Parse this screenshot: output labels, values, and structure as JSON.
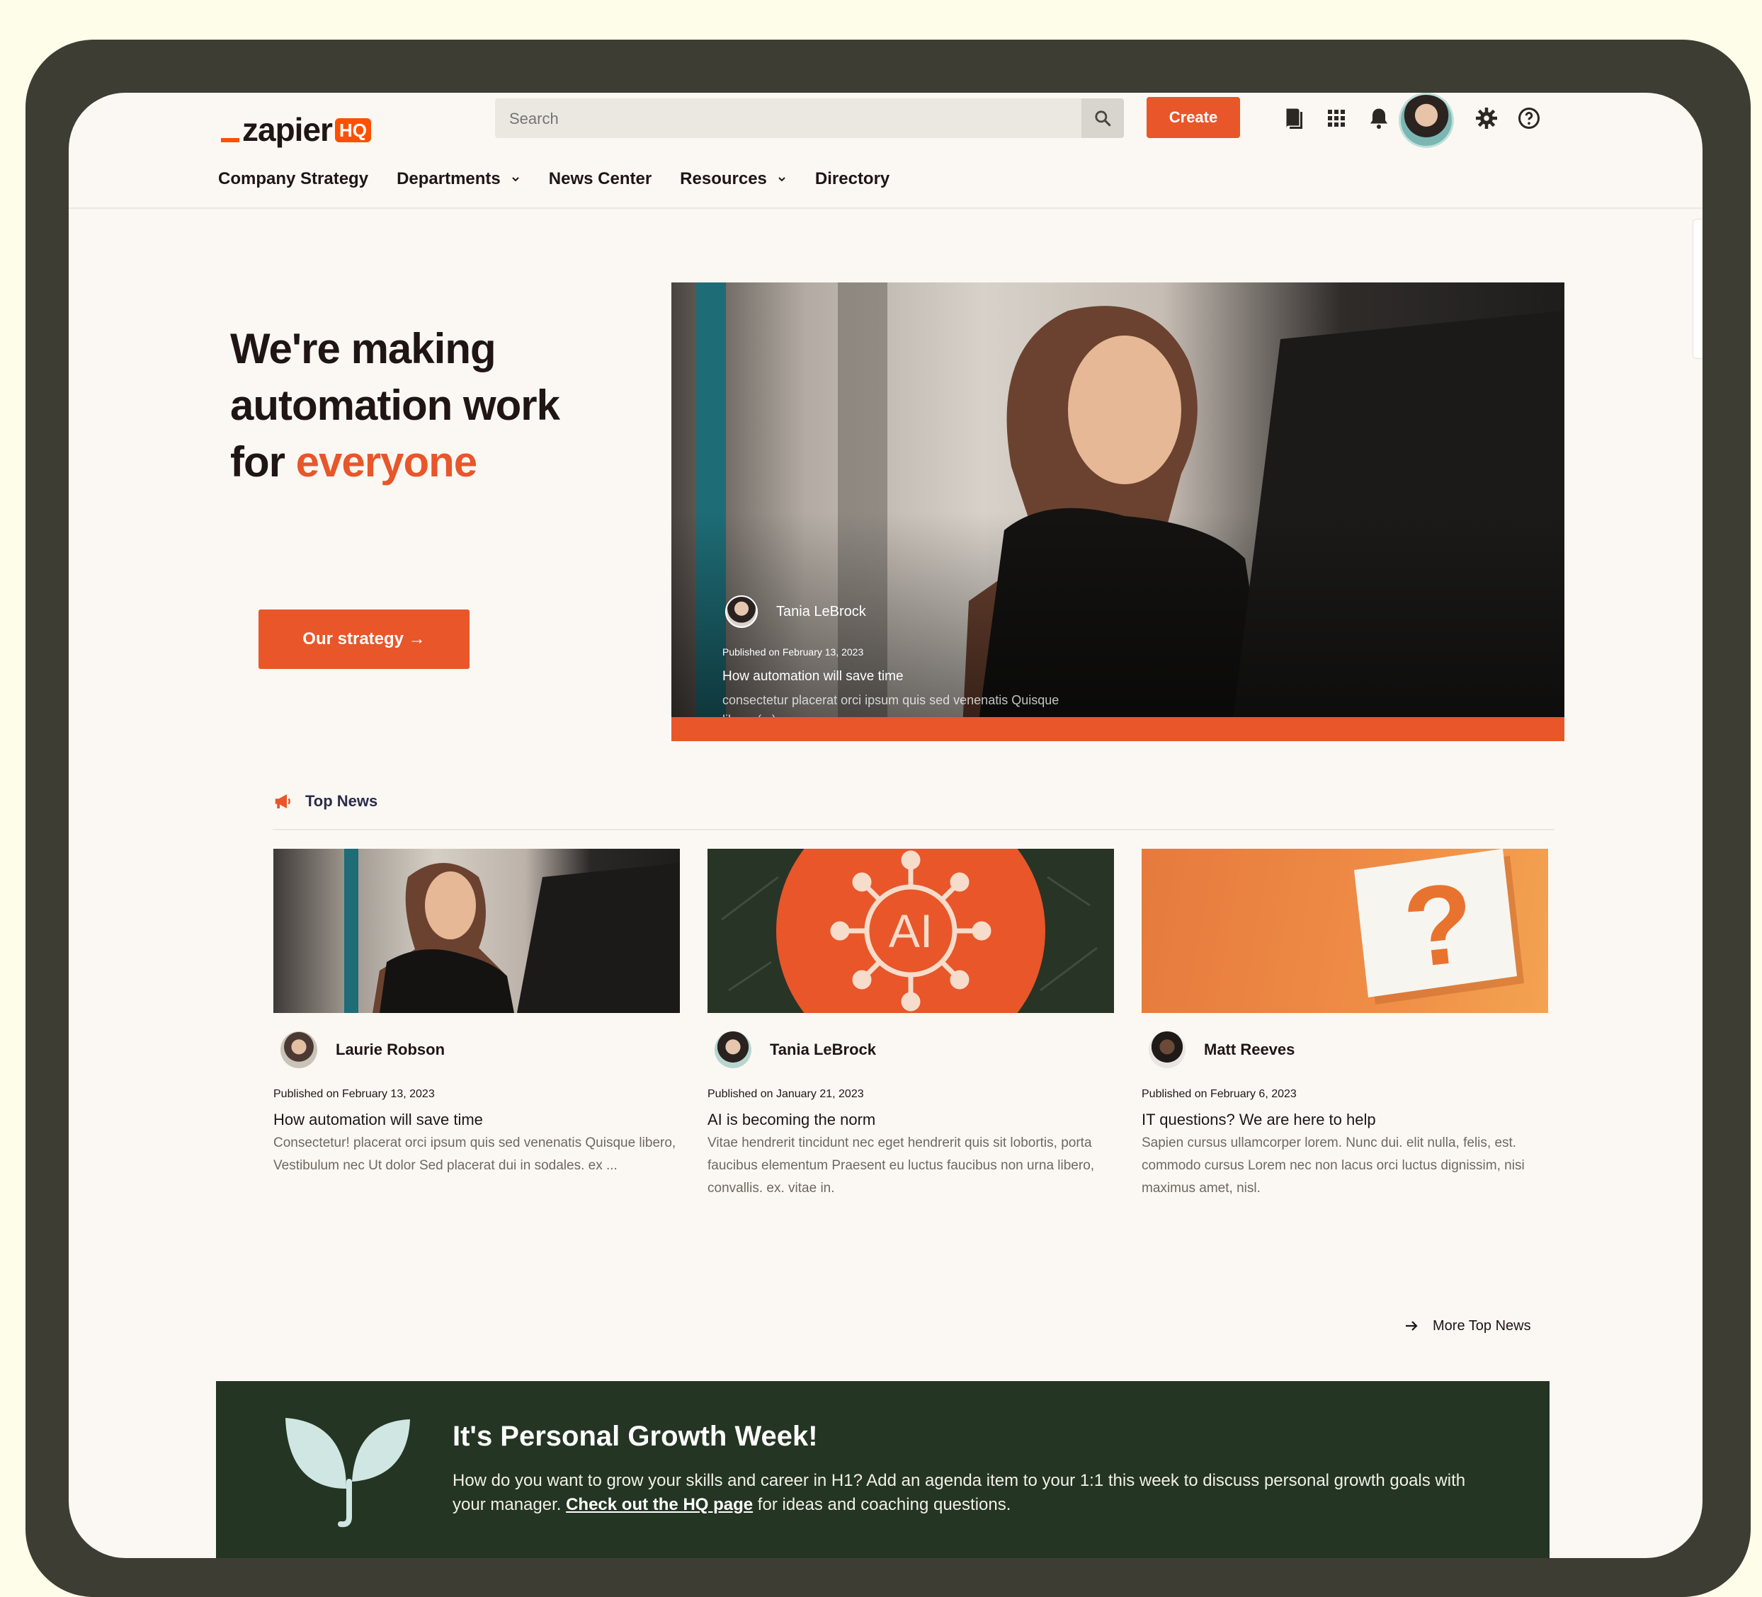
{
  "header": {
    "logo_word": "zapier",
    "logo_badge": "HQ",
    "search_placeholder": "Search",
    "create_label": "Create",
    "icons": [
      "book-icon",
      "apps-grid-icon",
      "bell-icon",
      "avatar",
      "gear-icon",
      "help-icon"
    ]
  },
  "nav": {
    "items": [
      {
        "label": "Company Strategy",
        "dropdown": false
      },
      {
        "label": "Departments",
        "dropdown": true
      },
      {
        "label": "News Center",
        "dropdown": false
      },
      {
        "label": "Resources",
        "dropdown": true
      },
      {
        "label": "Directory",
        "dropdown": false
      }
    ]
  },
  "hero": {
    "title_line1": "We're making",
    "title_line2": "automation work",
    "title_line3_plain": "for ",
    "title_line3_accent": "everyone",
    "cta_label": "Our strategy →",
    "feature": {
      "author": "Tania LeBrock",
      "date": "Published on February 13, 2023",
      "title": "How automation will save time",
      "excerpt": "consectetur placerat orci ipsum quis sed venenatis Quisque libero (...)"
    }
  },
  "top_news": {
    "label": "Top News",
    "cards": [
      {
        "author": "Laurie Robson",
        "date": "Published on February 13, 2023",
        "title": "How automation will save time",
        "excerpt": "Consectetur! placerat orci ipsum quis sed venenatis Quisque libero, Vestibulum nec Ut dolor Sed placerat dui in sodales. ex ..."
      },
      {
        "author": "Tania LeBrock",
        "date": "Published on January 21, 2023",
        "title": "AI is becoming the norm",
        "excerpt": "Vitae hendrerit tincidunt nec eget hendrerit quis sit lobortis, porta faucibus elementum Praesent eu luctus faucibus non urna libero, convallis. ex. vitae in.",
        "thumb_text": "AI"
      },
      {
        "author": "Matt Reeves",
        "date": "Published on February 6, 2023",
        "title": "IT questions? We are here to help",
        "excerpt": "Sapien cursus ullamcorper lorem. Nunc dui. elit nulla, felis, est. commodo cursus Lorem nec non lacus orci luctus dignissim, nisi maximus amet, nisl.",
        "thumb_text": "?"
      }
    ],
    "more_label": "More Top News"
  },
  "banner": {
    "title": "It's Personal Growth Week!",
    "body_before": "How do you want to grow your skills and career in H1? Add an agenda item to your 1:1 this week to discuss personal growth goals with your manager. ",
    "link_label": "Check out the HQ page",
    "body_after": " for ideas and coaching questions."
  },
  "colors": {
    "accent": "#e8562a",
    "dark_green": "#243523",
    "frame": "#3e3d33",
    "page_bg": "#fbf8f3"
  }
}
